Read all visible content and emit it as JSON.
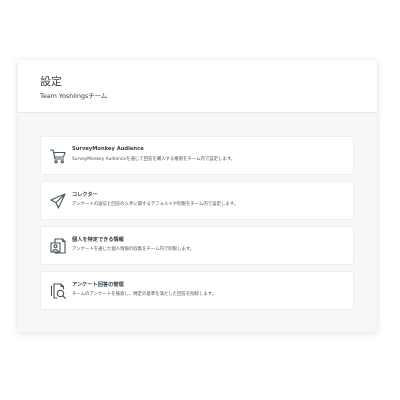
{
  "header": {
    "title": "設定",
    "team_name": "Team Yoshlingsチーム"
  },
  "settings": [
    {
      "icon": "cart-icon",
      "title": "SurveyMonkey Audience",
      "description": "SurveyMonkey Audienceを通じて回答を購入する権限をチーム内で設定します。"
    },
    {
      "icon": "paper-plane-icon",
      "title": "コレクター",
      "description": "アンケートの送信と回答の入手に関するデフォルトや制限をチーム内で設定します。"
    },
    {
      "icon": "personal-info-icon",
      "title": "個人を特定できる情報",
      "description": "アンケートを通じた個人情報の収集をチーム内で制限します。"
    },
    {
      "icon": "response-search-icon",
      "title": "アンケート回答の管理",
      "description": "チームのアンケートを検索し、特定の基準を満たした回答を削除します。"
    }
  ]
}
